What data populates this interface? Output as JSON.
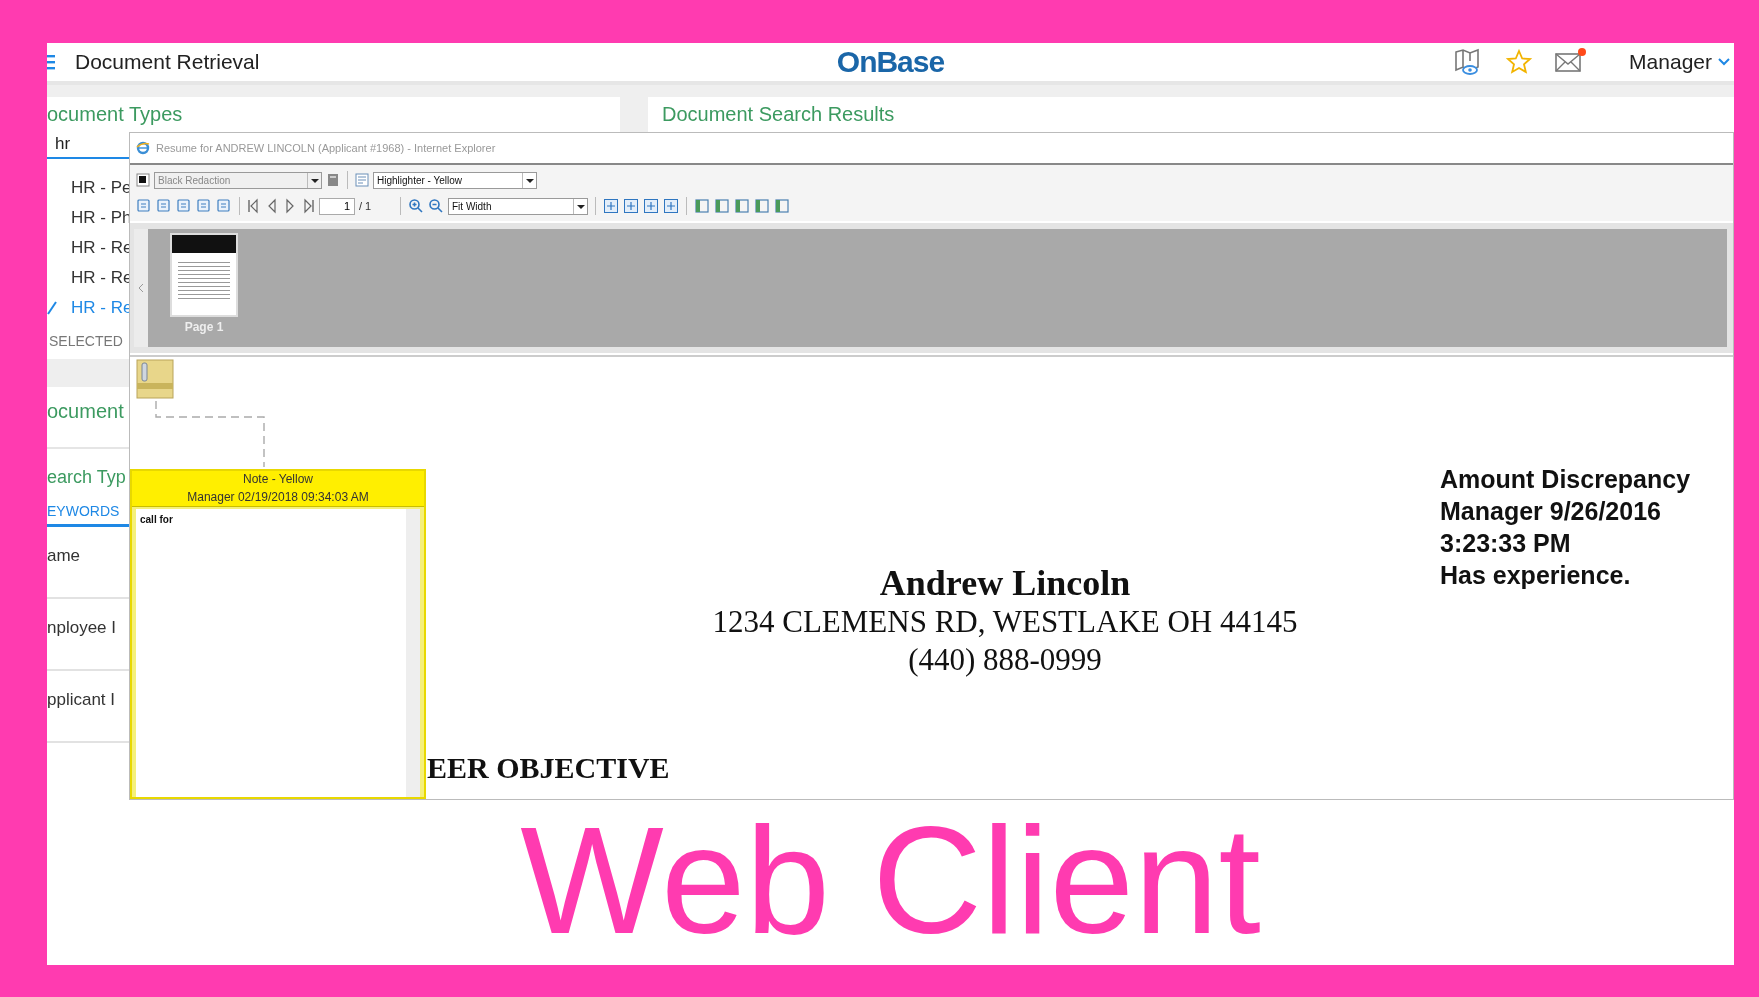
{
  "app_header": {
    "title": "Document Retrieval",
    "logo": "OnBase",
    "user": "Manager",
    "mail_unread": true
  },
  "document_types": {
    "heading": "ocument Types",
    "search": {
      "value": "hr"
    },
    "items": [
      {
        "label": "HR - Pe",
        "selected": false
      },
      {
        "label": "HR - Ph",
        "selected": false
      },
      {
        "label": "HR - Re",
        "selected": false
      },
      {
        "label": "HR - Re",
        "selected": false
      },
      {
        "label": "HR - Re",
        "selected": true
      }
    ],
    "selected_label": "SELECTED"
  },
  "document_section": {
    "heading": "ocument"
  },
  "search_types": {
    "heading": "earch Typ",
    "tabs": [
      {
        "label": "EYWORDS",
        "selected": true
      }
    ],
    "fields": [
      {
        "label": "ame"
      },
      {
        "label": "nployee I"
      },
      {
        "label": "pplicant I"
      }
    ]
  },
  "results": {
    "heading": "Document Search Results"
  },
  "viewer": {
    "title": "Resume for ANDREW LINCOLN (Applicant #1968) - Internet Explorer",
    "redaction": {
      "value": "Black Redaction",
      "disabled": true
    },
    "highlighter": "Highlighter - Yellow",
    "page": "1",
    "page_total": "/ 1",
    "zoom": "Fit Width",
    "thumbnail_label": "Page 1"
  },
  "note": {
    "title": "Note - Yellow",
    "meta": "Manager 02/19/2018 09:34:03 AM",
    "text": "call for"
  },
  "document": {
    "name": "Andrew Lincoln",
    "address": "1234 CLEMENS RD, WESTLAKE OH 44145",
    "phone": "(440) 888-0999",
    "section": "EER OBJECTIVE"
  },
  "annotation": {
    "lines": [
      "Amount Discrepancy",
      "Manager 9/26/2016",
      "3:23:33 PM",
      "Has experience."
    ]
  },
  "caption": "Web Client"
}
